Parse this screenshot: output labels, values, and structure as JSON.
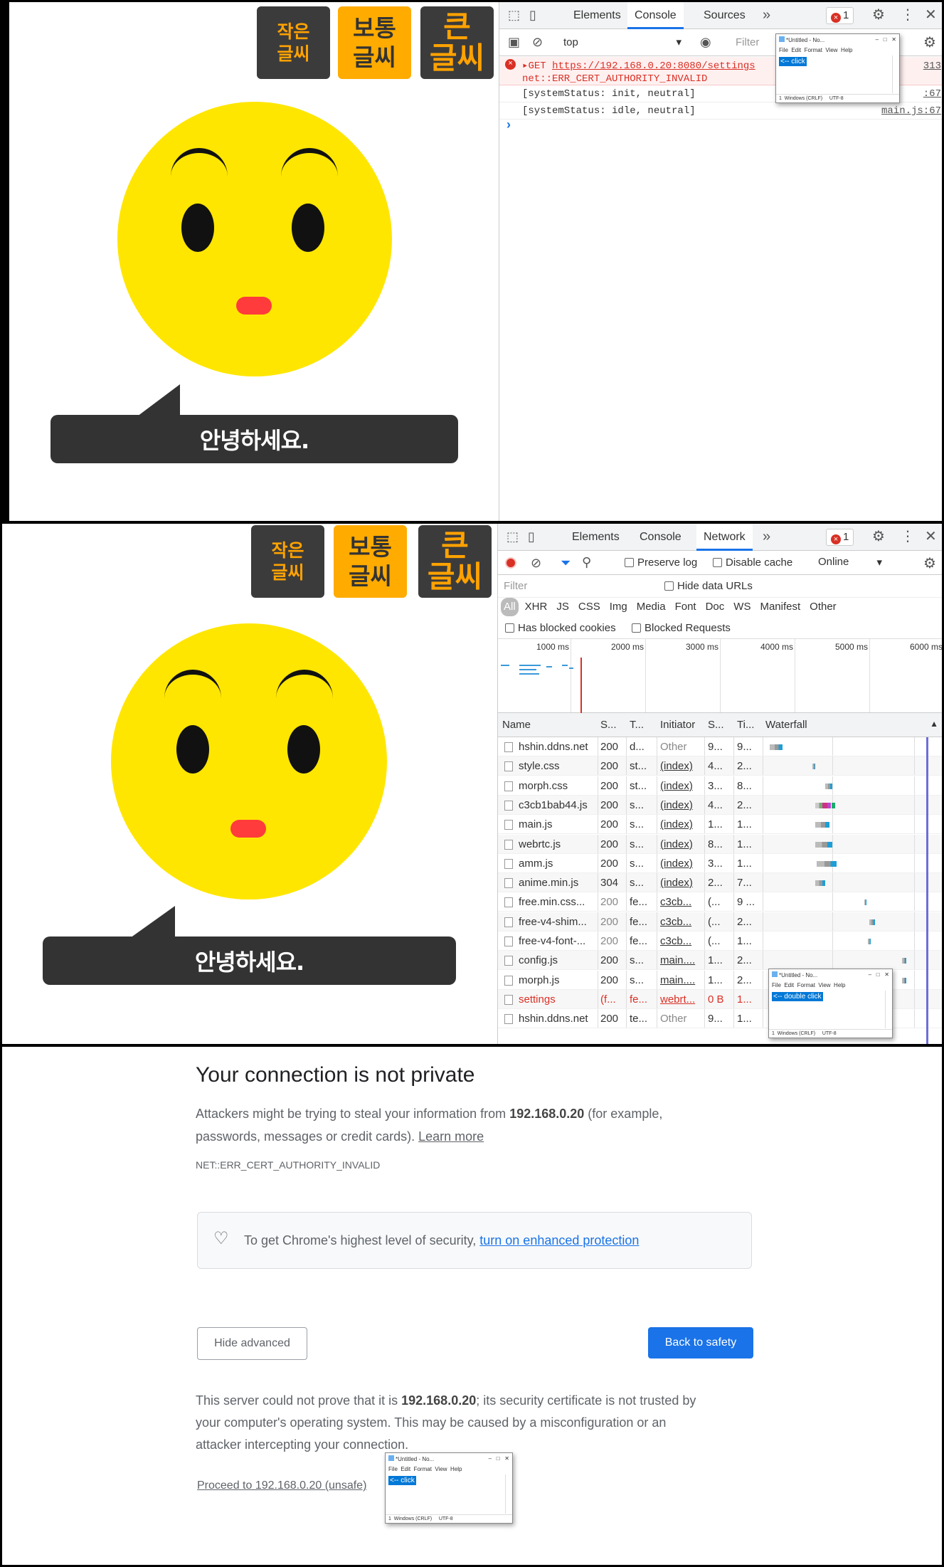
{
  "app": {
    "buttons": [
      {
        "line1": "작은",
        "line2": "글씨"
      },
      {
        "line1": "보통",
        "line2": "글씨"
      },
      {
        "line1": "큰",
        "line2": "글씨"
      }
    ],
    "speech": "안녕하세요."
  },
  "devtools": {
    "tabs": [
      "Elements",
      "Console",
      "Sources",
      "Network"
    ],
    "more": "»",
    "error_count": "1",
    "console": {
      "context": "top",
      "filter_placeholder": "Filter",
      "error_method": "GET",
      "error_url": "https://192.168.0.20:8080/settings",
      "error_code": "net::ERR_CERT_AUTHORITY_INVALID",
      "error_source": "313",
      "log1": "[systemStatus:   init,  neutral]",
      "log1_source": ":67",
      "log2": "[systemStatus:   idle,  neutral]",
      "log2_source": "main.js:67",
      "prompt": "›"
    },
    "network": {
      "preserve_log": "Preserve log",
      "disable_cache": "Disable cache",
      "throttle": "Online",
      "filter_placeholder": "Filter",
      "hide_data_urls": "Hide data URLs",
      "types": [
        "All",
        "XHR",
        "JS",
        "CSS",
        "Img",
        "Media",
        "Font",
        "Doc",
        "WS",
        "Manifest",
        "Other"
      ],
      "blocked_cookies": "Has blocked cookies",
      "blocked_requests": "Blocked Requests",
      "timeline": [
        "1000 ms",
        "2000 ms",
        "3000 ms",
        "4000 ms",
        "5000 ms",
        "6000 ms"
      ],
      "columns": [
        "Name",
        "S...",
        "T...",
        "Initiator",
        "S...",
        "Ti...",
        "Waterfall"
      ],
      "rows": [
        {
          "name": "hshin.ddns.net",
          "status": "200",
          "type": "d...",
          "initiator": "Other",
          "size": "9...",
          "time": "9..."
        },
        {
          "name": "style.css",
          "status": "200",
          "type": "st...",
          "initiator": "(index)",
          "size": "4...",
          "time": "2..."
        },
        {
          "name": "morph.css",
          "status": "200",
          "type": "st...",
          "initiator": "(index)",
          "size": "3...",
          "time": "8..."
        },
        {
          "name": "c3cb1bab44.js",
          "status": "200",
          "type": "s...",
          "initiator": "(index)",
          "size": "4...",
          "time": "2..."
        },
        {
          "name": "main.js",
          "status": "200",
          "type": "s...",
          "initiator": "(index)",
          "size": "1...",
          "time": "1..."
        },
        {
          "name": "webrtc.js",
          "status": "200",
          "type": "s...",
          "initiator": "(index)",
          "size": "8...",
          "time": "1..."
        },
        {
          "name": "amm.js",
          "status": "200",
          "type": "s...",
          "initiator": "(index)",
          "size": "3...",
          "time": "1..."
        },
        {
          "name": "anime.min.js",
          "status": "304",
          "type": "s...",
          "initiator": "(index)",
          "size": "2...",
          "time": "7..."
        },
        {
          "name": "free.min.css...",
          "status": "200",
          "type": "fe...",
          "initiator": "c3cb...",
          "size": "(...",
          "time": "9 ..."
        },
        {
          "name": "free-v4-shim...",
          "status": "200",
          "type": "fe...",
          "initiator": "c3cb...",
          "size": "(...",
          "time": "2..."
        },
        {
          "name": "free-v4-font-...",
          "status": "200",
          "type": "fe...",
          "initiator": "c3cb...",
          "size": "(...",
          "time": "1..."
        },
        {
          "name": "config.js",
          "status": "200",
          "type": "s...",
          "initiator": "main....",
          "size": "1...",
          "time": "2..."
        },
        {
          "name": "morph.js",
          "status": "200",
          "type": "s...",
          "initiator": "main....",
          "size": "1...",
          "time": "2..."
        },
        {
          "name": "settings",
          "status": "(f...",
          "type": "fe...",
          "initiator": "webrt...",
          "size": "0 B",
          "time": "1..."
        },
        {
          "name": "hshin.ddns.net",
          "status": "200",
          "type": "te...",
          "initiator": "Other",
          "size": "9...",
          "time": "1..."
        }
      ]
    }
  },
  "notepad": {
    "title": "*Untitled - No...",
    "menu": [
      "File",
      "Edit",
      "Format",
      "View",
      "Help"
    ],
    "status_eol": "Windows (CRLF)",
    "status_enc": "UTF-8",
    "status_pos": "1",
    "text_click": "<-- click",
    "text_double": "<-- double click"
  },
  "interstitial": {
    "title": "Your connection is not private",
    "p1_a": "Attackers might be trying to steal your information from ",
    "host": "192.168.0.20",
    "p1_b": " (for example,",
    "p1_c": "passwords, messages or credit cards). ",
    "learn_more": "Learn more",
    "error_code": "NET::ERR_CERT_AUTHORITY_INVALID",
    "protect_text": "To get Chrome's highest level of security, ",
    "protect_link": "turn on enhanced protection",
    "hide_advanced": "Hide advanced",
    "back_to_safety": "Back to safety",
    "p2_a": "This server could not prove that it is ",
    "p2_b": "; its security certificate is not trusted by",
    "p2_c": "your computer's operating system. This may be caused by a misconfiguration or an",
    "p2_d": "attacker intercepting your connection.",
    "proceed": "Proceed to 192.168.0.20 (unsafe)"
  }
}
